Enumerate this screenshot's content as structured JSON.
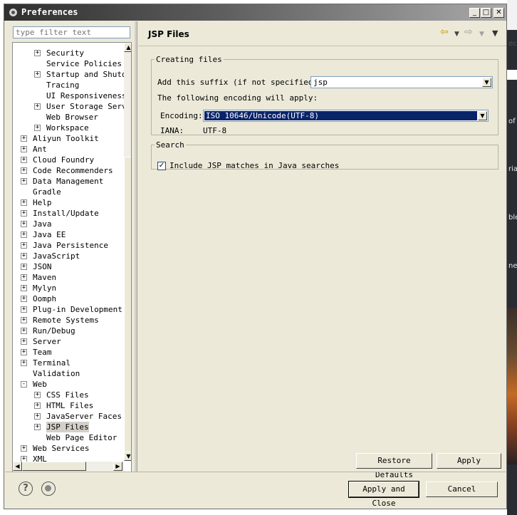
{
  "window": {
    "title": "Preferences"
  },
  "titlebar_buttons": {
    "minimize": "_",
    "maximize": "□",
    "close": "✕"
  },
  "filter": {
    "placeholder": "type filter text"
  },
  "tree": [
    {
      "label": "Security",
      "level": 2,
      "exp": "+"
    },
    {
      "label": "Service Policies",
      "level": 2,
      "exp": ""
    },
    {
      "label": "Startup and Shutdown",
      "level": 2,
      "exp": "+"
    },
    {
      "label": "Tracing",
      "level": 2,
      "exp": ""
    },
    {
      "label": "UI Responsiveness",
      "level": 2,
      "exp": ""
    },
    {
      "label": "User Storage Service",
      "level": 2,
      "exp": "+"
    },
    {
      "label": "Web Browser",
      "level": 2,
      "exp": ""
    },
    {
      "label": "Workspace",
      "level": 2,
      "exp": "+"
    },
    {
      "label": "Aliyun Toolkit",
      "level": 1,
      "exp": "+"
    },
    {
      "label": "Ant",
      "level": 1,
      "exp": "+"
    },
    {
      "label": "Cloud Foundry",
      "level": 1,
      "exp": "+"
    },
    {
      "label": "Code Recommenders",
      "level": 1,
      "exp": "+"
    },
    {
      "label": "Data Management",
      "level": 1,
      "exp": "+"
    },
    {
      "label": "Gradle",
      "level": 1,
      "exp": ""
    },
    {
      "label": "Help",
      "level": 1,
      "exp": "+"
    },
    {
      "label": "Install/Update",
      "level": 1,
      "exp": "+"
    },
    {
      "label": "Java",
      "level": 1,
      "exp": "+"
    },
    {
      "label": "Java EE",
      "level": 1,
      "exp": "+"
    },
    {
      "label": "Java Persistence",
      "level": 1,
      "exp": "+"
    },
    {
      "label": "JavaScript",
      "level": 1,
      "exp": "+"
    },
    {
      "label": "JSON",
      "level": 1,
      "exp": "+"
    },
    {
      "label": "Maven",
      "level": 1,
      "exp": "+"
    },
    {
      "label": "Mylyn",
      "level": 1,
      "exp": "+"
    },
    {
      "label": "Oomph",
      "level": 1,
      "exp": "+"
    },
    {
      "label": "Plug-in Development",
      "level": 1,
      "exp": "+"
    },
    {
      "label": "Remote Systems",
      "level": 1,
      "exp": "+"
    },
    {
      "label": "Run/Debug",
      "level": 1,
      "exp": "+"
    },
    {
      "label": "Server",
      "level": 1,
      "exp": "+"
    },
    {
      "label": "Team",
      "level": 1,
      "exp": "+"
    },
    {
      "label": "Terminal",
      "level": 1,
      "exp": "+"
    },
    {
      "label": "Validation",
      "level": 1,
      "exp": ""
    },
    {
      "label": "Web",
      "level": 1,
      "exp": "-"
    },
    {
      "label": "CSS Files",
      "level": 2,
      "exp": "+"
    },
    {
      "label": "HTML Files",
      "level": 2,
      "exp": "+"
    },
    {
      "label": "JavaServer Faces Tools",
      "level": 2,
      "exp": "+"
    },
    {
      "label": "JSP Files",
      "level": 2,
      "exp": "+",
      "selected": true
    },
    {
      "label": "Web Page Editor",
      "level": 2,
      "exp": ""
    },
    {
      "label": "Web Services",
      "level": 1,
      "exp": "+"
    },
    {
      "label": "XML",
      "level": 1,
      "exp": "+"
    }
  ],
  "page": {
    "title": "JSP Files",
    "back_icon": "back-arrow-icon",
    "forward_icon": "forward-arrow-icon",
    "menu_icon": "view-menu-icon"
  },
  "creating_files": {
    "legend": "Creating files",
    "suffix_label": "Add this suffix (if not specified):",
    "suffix_value": "jsp",
    "encoding_note": "The following encoding will apply:",
    "encoding_label": "Encoding:",
    "encoding_value": "ISO 10646/Unicode(UTF-8)",
    "iana_label": "IANA:",
    "iana_value": "UTF-8"
  },
  "search": {
    "legend": "Search",
    "include_label": "Include JSP matches in Java searches",
    "include_checked": true,
    "check_mark": "✓"
  },
  "buttons": {
    "restore_defaults": "Restore Defaults",
    "apply": "Apply",
    "apply_and_close": "Apply and Close",
    "cancel": "Cancel"
  },
  "footer": {
    "help_glyph": "?",
    "help_icon": "help-icon",
    "import_icon": "import-export-icon"
  },
  "background": {
    "fragments": [
      "ecc",
      "of",
      "rial",
      "ble",
      "ne"
    ]
  },
  "colors": {
    "selection": "#0a246a",
    "window": "#ece9d8",
    "tree_selected": "#d4d0c8"
  }
}
